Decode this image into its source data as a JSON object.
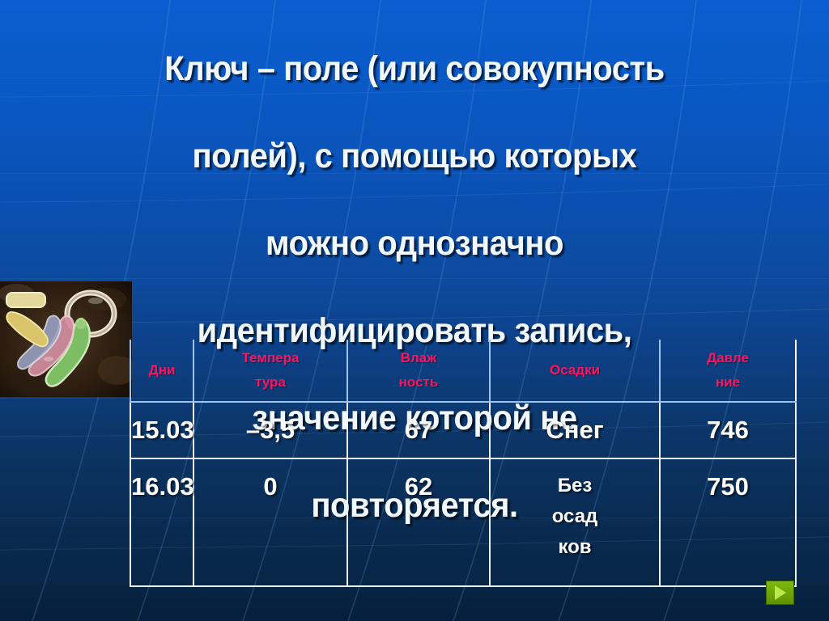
{
  "slide": {
    "title_lines": [
      "Ключ – поле (или совокупность",
      "полей), с помощью которых",
      "можно однозначно",
      "идентифицировать запись,",
      "значение которой не",
      "повторяется."
    ],
    "background_color_top": "#0b5ed0",
    "background_color_bottom": "#061f3b",
    "header_text_color": "#ff1464",
    "body_text_color": "#ffffff"
  },
  "photo": {
    "alt": "keys-on-keyring-photo"
  },
  "table": {
    "headers": [
      {
        "line1": "Дни",
        "line2": ""
      },
      {
        "line1": "Темпера",
        "line2": "тура"
      },
      {
        "line1": "Влаж",
        "line2": "ность"
      },
      {
        "line1": "Осадки",
        "line2": ""
      },
      {
        "line1": "Давле",
        "line2": "ние"
      }
    ],
    "rows": [
      {
        "day": "15.03",
        "temperature": "–3,5",
        "humidity": "67",
        "precipitation": "Снег",
        "precipitation_lines": [
          "Снег"
        ],
        "pressure": "746"
      },
      {
        "day": "16.03",
        "temperature": "0",
        "humidity": "62",
        "precipitation": "Без осад ков",
        "precipitation_lines": [
          "Без",
          "осад",
          "ков"
        ],
        "pressure": "750"
      }
    ]
  },
  "controls": {
    "next_label": "▶"
  }
}
